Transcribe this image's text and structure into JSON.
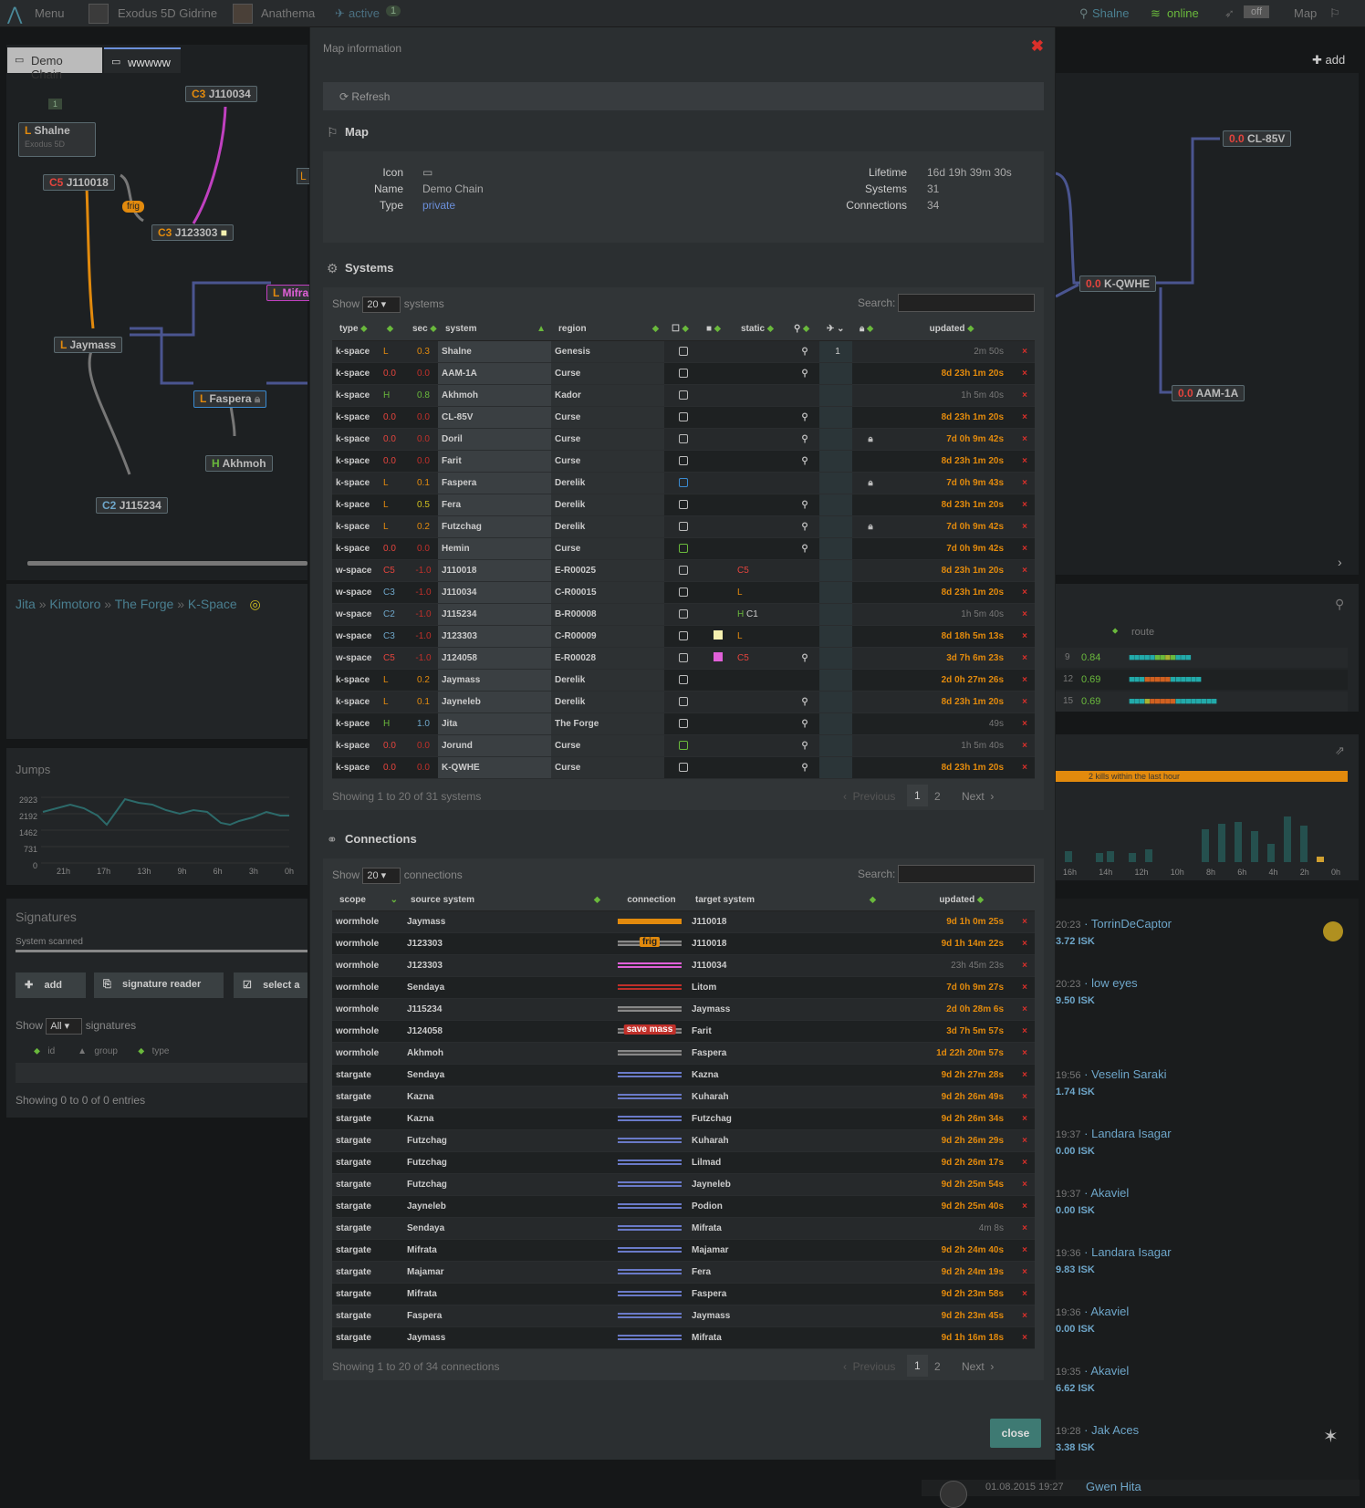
{
  "topbar": {
    "menu": "Menu",
    "char1": "Exodus 5D Gidrine",
    "char2": "Anathema",
    "active": "active",
    "active_count": "1",
    "location": "Shalne",
    "online": "online",
    "toggle": "off",
    "map": "Map"
  },
  "tabs": {
    "tab1": "Demo Chain",
    "tab2": "wwwww",
    "add": "add"
  },
  "nodes": [
    {
      "cls": "C3",
      "name": "J110034"
    },
    {
      "cls": "L",
      "name": "Shalne"
    },
    {
      "cls": "C5",
      "name": "J110018"
    },
    {
      "cls": "C3",
      "name": "J123303"
    },
    {
      "cls": "L",
      "name": "Mifra"
    },
    {
      "cls": "L",
      "name": "Jaymass"
    },
    {
      "cls": "L",
      "name": "Faspera"
    },
    {
      "cls": "H",
      "name": "Akhmoh"
    },
    {
      "cls": "C2",
      "name": "J115234"
    },
    {
      "cls": "0.0",
      "name": "CL-85V"
    },
    {
      "cls": "0.0",
      "name": "K-QWHE"
    },
    {
      "cls": "0.0",
      "name": "AAM-1A"
    }
  ],
  "map_extra": {
    "shalne_sub": "Exodus 5D",
    "frig": "frig",
    "counter": "1",
    "left_stub": "L"
  },
  "breadcrumb": {
    "a": "Jita",
    "b": "Kimotoro",
    "c": "The Forge",
    "d": "K-Space"
  },
  "jumps": {
    "title": "Jumps",
    "y": [
      "2923",
      "2192",
      "1462",
      "731",
      "0"
    ],
    "x": [
      "21h",
      "17h",
      "13h",
      "9h",
      "6h",
      "3h",
      "0h"
    ]
  },
  "signatures": {
    "title": "Signatures",
    "scanned": "System scanned",
    "add": "add",
    "reader": "signature reader",
    "select": "select a",
    "show": "Show",
    "all": "All",
    "suffix": "signatures",
    "cols": [
      "id",
      "group",
      "type"
    ],
    "footer": "Showing 0 to 0 of 0 entries"
  },
  "route": {
    "head": "route",
    "rows": [
      {
        "j": "9",
        "s": "0.84"
      },
      {
        "j": "12",
        "s": "0.69"
      },
      {
        "j": "15",
        "s": "0.69"
      }
    ]
  },
  "killbar": "2 kills within the last hour",
  "killx": [
    "16h",
    "14h",
    "12h",
    "10h",
    "8h",
    "6h",
    "4h",
    "2h",
    "0h"
  ],
  "kills": [
    {
      "t": "20:23",
      "n": "TorrinDeCaptor",
      "isk": "3.72 ISK"
    },
    {
      "t": "20:23",
      "n": "low eyes",
      "isk": "9.50 ISK"
    },
    {
      "t": "19:56",
      "n": "Veselin Saraki",
      "isk": "1.74 ISK"
    },
    {
      "t": "19:37",
      "n": "Landara Isagar",
      "isk": "0.00 ISK"
    },
    {
      "t": "19:37",
      "n": "Akaviel",
      "isk": "0.00 ISK"
    },
    {
      "t": "19:36",
      "n": "Landara Isagar",
      "isk": "9.83 ISK"
    },
    {
      "t": "19:36",
      "n": "Akaviel",
      "isk": "0.00 ISK"
    },
    {
      "t": "19:35",
      "n": "Akaviel",
      "isk": "6.62 ISK"
    },
    {
      "t": "19:28",
      "n": "Jak Aces",
      "isk": "3.38 ISK"
    }
  ],
  "kill_last": {
    "t": "01.08.2015 19:27",
    "n": "Gwen Hita"
  },
  "modal": {
    "title": "Map information",
    "refresh": "Refresh",
    "map_section": "Map",
    "close": "close",
    "info": {
      "icon_label": "Icon",
      "name_label": "Name",
      "name": "Demo Chain",
      "type_label": "Type",
      "type": "private",
      "lifetime_label": "Lifetime",
      "lifetime": "16d 19h 39m 30s",
      "systems_label": "Systems",
      "systems": "31",
      "connections_label": "Connections",
      "connections": "34"
    }
  },
  "systems": {
    "title": "Systems",
    "show": "Show",
    "len": "20",
    "suffix": "systems",
    "search": "Search:",
    "headers": [
      "type",
      "sec",
      "system",
      "region",
      "static",
      "updated"
    ],
    "footer": "Showing 1 to 20 of 31 systems",
    "prev": "Previous",
    "p1": "1",
    "p2": "2",
    "next": "Next",
    "rows": [
      [
        "k-space",
        "L",
        "0.3",
        "Shalne",
        "Genesis",
        "",
        "",
        "",
        "pin",
        "1",
        "",
        "2m 50s",
        "g"
      ],
      [
        "k-space",
        "0.0",
        "0.0",
        "AAM-1A",
        "Curse",
        "",
        "",
        "",
        "pin",
        "",
        "",
        "8d 23h 1m 20s",
        "o"
      ],
      [
        "k-space",
        "H",
        "0.8",
        "Akhmoh",
        "Kador",
        "",
        "",
        "",
        "",
        "",
        "",
        "1h 5m 40s",
        "g"
      ],
      [
        "k-space",
        "0.0",
        "0.0",
        "CL-85V",
        "Curse",
        "",
        "",
        "",
        "pin",
        "",
        "",
        "8d 23h 1m 20s",
        "o"
      ],
      [
        "k-space",
        "0.0",
        "0.0",
        "Doril",
        "Curse",
        "",
        "",
        "",
        "pin",
        "",
        "lock",
        "7d 0h 9m 42s",
        "o"
      ],
      [
        "k-space",
        "0.0",
        "0.0",
        "Farit",
        "Curse",
        "",
        "",
        "",
        "pin",
        "",
        "",
        "8d 23h 1m 20s",
        "o"
      ],
      [
        "k-space",
        "L",
        "0.1",
        "Faspera",
        "Derelik",
        "blue",
        "",
        "",
        "",
        "",
        "lock",
        "7d 0h 9m 43s",
        "o"
      ],
      [
        "k-space",
        "L",
        "0.5",
        "Fera",
        "Derelik",
        "",
        "",
        "",
        "pin",
        "",
        "",
        "8d 23h 1m 20s",
        "o"
      ],
      [
        "k-space",
        "L",
        "0.2",
        "Futzchag",
        "Derelik",
        "",
        "",
        "",
        "pin",
        "",
        "lock",
        "7d 0h 9m 42s",
        "o"
      ],
      [
        "k-space",
        "0.0",
        "0.0",
        "Hemin",
        "Curse",
        "green",
        "",
        "",
        "pin",
        "",
        "",
        "7d 0h 9m 42s",
        "o"
      ],
      [
        "w-space",
        "C5",
        "-1.0",
        "J110018",
        "E-R00025",
        "",
        "",
        "C5",
        "",
        "",
        "",
        "8d 23h 1m 20s",
        "o"
      ],
      [
        "w-space",
        "C3",
        "-1.0",
        "J110034",
        "C-R00015",
        "",
        "",
        "L",
        "",
        "",
        "",
        "8d 23h 1m 20s",
        "o"
      ],
      [
        "w-space",
        "C2",
        "-1.0",
        "J115234",
        "B-R00008",
        "",
        "",
        "H C1",
        "",
        "",
        "",
        "1h 5m 40s",
        "g"
      ],
      [
        "w-space",
        "C3",
        "-1.0",
        "J123303",
        "C-R00009",
        "",
        "#f5f0b0",
        "L",
        "",
        "",
        "",
        "8d 18h 5m 13s",
        "o"
      ],
      [
        "w-space",
        "C5",
        "-1.0",
        "J124058",
        "E-R00028",
        "",
        "#e060d8",
        "C5",
        "pin",
        "",
        "",
        "3d 7h 6m 23s",
        "o"
      ],
      [
        "k-space",
        "L",
        "0.2",
        "Jaymass",
        "Derelik",
        "",
        "",
        "",
        "",
        "",
        "",
        "2d 0h 27m 26s",
        "o"
      ],
      [
        "k-space",
        "L",
        "0.1",
        "Jayneleb",
        "Derelik",
        "",
        "",
        "",
        "pin",
        "",
        "",
        "8d 23h 1m 20s",
        "o"
      ],
      [
        "k-space",
        "H",
        "1.0",
        "Jita",
        "The Forge",
        "",
        "",
        "",
        "pin",
        "",
        "",
        "49s",
        "g"
      ],
      [
        "k-space",
        "0.0",
        "0.0",
        "Jorund",
        "Curse",
        "green",
        "",
        "",
        "pin",
        "",
        "",
        "1h 5m 40s",
        "g"
      ],
      [
        "k-space",
        "0.0",
        "0.0",
        "K-QWHE",
        "Curse",
        "",
        "",
        "",
        "pin",
        "",
        "",
        "8d 23h 1m 20s",
        "o"
      ]
    ]
  },
  "connections": {
    "title": "Connections",
    "show": "Show",
    "len": "20",
    "suffix": "connections",
    "search": "Search:",
    "headers": [
      "scope",
      "source system",
      "connection",
      "target system",
      "updated"
    ],
    "footer": "Showing 1 to 20 of 34 connections",
    "prev": "Previous",
    "p1": "1",
    "p2": "2",
    "next": "Next",
    "rows": [
      [
        "wormhole",
        "Jaymass",
        "orange",
        "",
        "J110018",
        "9d 1h 0m 25s",
        "o"
      ],
      [
        "wormhole",
        "J123303",
        "gray",
        "frig",
        "J110018",
        "9d 1h 14m 22s",
        "o"
      ],
      [
        "wormhole",
        "J123303",
        "magenta",
        "",
        "J110034",
        "23h 45m 23s",
        "g"
      ],
      [
        "wormhole",
        "Sendaya",
        "red",
        "",
        "Litom",
        "7d 0h 9m 27s",
        "o"
      ],
      [
        "wormhole",
        "J115234",
        "gray",
        "",
        "Jaymass",
        "2d 0h 28m 6s",
        "o"
      ],
      [
        "wormhole",
        "J124058",
        "gray",
        "save mass",
        "Farit",
        "3d 7h 5m 57s",
        "o"
      ],
      [
        "wormhole",
        "Akhmoh",
        "gray",
        "",
        "Faspera",
        "1d 22h 20m 57s",
        "o"
      ],
      [
        "stargate",
        "Sendaya",
        "blue",
        "",
        "Kazna",
        "9d 2h 27m 28s",
        "o"
      ],
      [
        "stargate",
        "Kazna",
        "blue",
        "",
        "Kuharah",
        "9d 2h 26m 49s",
        "o"
      ],
      [
        "stargate",
        "Kazna",
        "blue",
        "",
        "Futzchag",
        "9d 2h 26m 34s",
        "o"
      ],
      [
        "stargate",
        "Futzchag",
        "blue",
        "",
        "Kuharah",
        "9d 2h 26m 29s",
        "o"
      ],
      [
        "stargate",
        "Futzchag",
        "blue",
        "",
        "Lilmad",
        "9d 2h 26m 17s",
        "o"
      ],
      [
        "stargate",
        "Futzchag",
        "blue",
        "",
        "Jayneleb",
        "9d 2h 25m 54s",
        "o"
      ],
      [
        "stargate",
        "Jayneleb",
        "blue",
        "",
        "Podion",
        "9d 2h 25m 40s",
        "o"
      ],
      [
        "stargate",
        "Sendaya",
        "blue",
        "",
        "Mifrata",
        "4m 8s",
        "g"
      ],
      [
        "stargate",
        "Mifrata",
        "blue",
        "",
        "Majamar",
        "9d 2h 24m 40s",
        "o"
      ],
      [
        "stargate",
        "Majamar",
        "blue",
        "",
        "Fera",
        "9d 2h 24m 19s",
        "o"
      ],
      [
        "stargate",
        "Mifrata",
        "blue",
        "",
        "Faspera",
        "9d 2h 23m 58s",
        "o"
      ],
      [
        "stargate",
        "Faspera",
        "blue",
        "",
        "Jaymass",
        "9d 2h 23m 45s",
        "o"
      ],
      [
        "stargate",
        "Jaymass",
        "blue",
        "",
        "Mifrata",
        "9d 1h 16m 18s",
        "o"
      ]
    ]
  }
}
